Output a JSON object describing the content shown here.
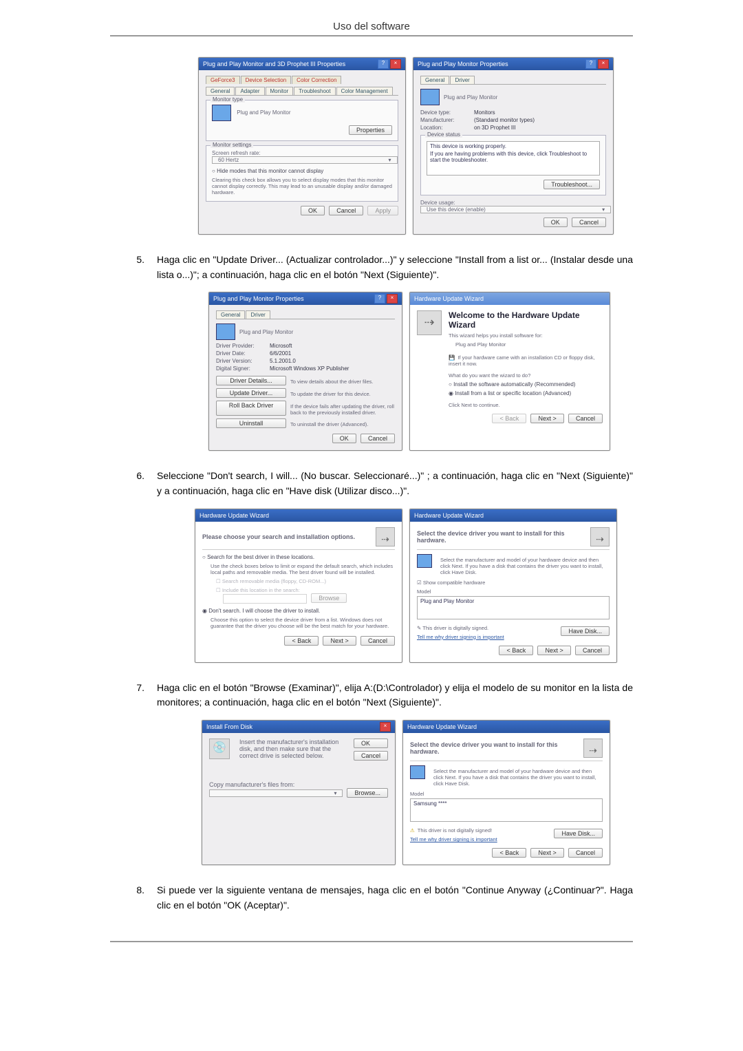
{
  "page_header": "Uso del software",
  "step5": {
    "num": "5.",
    "text": "Haga clic en \"Update Driver... (Actualizar controlador...)\" y seleccione \"Install from a list or... (Instalar desde una lista o...)\"; a continuación, haga clic en el botón \"Next (Siguiente)\"."
  },
  "step6": {
    "num": "6.",
    "text": "Seleccione \"Don't search, I will... (No buscar. Seleccionaré...)\" ; a continuación, haga clic en \"Next (Siguiente)\" y a continuación, haga clic en \"Have disk (Utilizar disco...)\"."
  },
  "step7": {
    "num": "7.",
    "text": "Haga clic en el botón \"Browse (Examinar)\", elija A:(D:\\Controlador) y elija el modelo de su monitor en la lista de monitores; a continuación, haga clic en el botón \"Next (Siguiente)\"."
  },
  "step8": {
    "num": "8.",
    "text": "Si puede ver la siguiente ventana de mensajes, haga clic en el botón \"Continue Anyway (¿Continuar?\". Haga clic en el botón \"OK (Aceptar)\"."
  },
  "dlg1a": {
    "title": "Plug and Play Monitor and 3D Prophet III Properties",
    "tabs": [
      "GeForce3",
      "Device Selection",
      "Color Correction",
      "General",
      "Adapter",
      "Monitor",
      "Troubleshoot",
      "Color Management"
    ],
    "grp_type": "Monitor type",
    "monitor": "Plug and Play Monitor",
    "btn_props": "Properties",
    "grp_settings": "Monitor settings",
    "lbl_refresh": "Screen refresh rate:",
    "val_refresh": "60 Hertz",
    "chk": "Hide modes that this monitor cannot display",
    "chk_note": "Clearing this check box allows you to select display modes that this monitor cannot display correctly. This may lead to an unusable display and/or damaged hardware.",
    "ok": "OK",
    "cancel": "Cancel",
    "apply": "Apply"
  },
  "dlg1b": {
    "title": "Plug and Play Monitor Properties",
    "tabs": [
      "General",
      "Driver"
    ],
    "name": "Plug and Play Monitor",
    "f_type_l": "Device type:",
    "f_type_v": "Monitors",
    "f_manu_l": "Manufacturer:",
    "f_manu_v": "(Standard monitor types)",
    "f_loc_l": "Location:",
    "f_loc_v": "on 3D Prophet III",
    "grp_status": "Device status",
    "status_txt": "This device is working properly.",
    "status_txt2": "If you are having problems with this device, click Troubleshoot to start the troubleshooter.",
    "btn_trouble": "Troubleshoot...",
    "lbl_usage": "Device usage:",
    "val_usage": "Use this device (enable)",
    "ok": "OK",
    "cancel": "Cancel"
  },
  "dlg2a": {
    "title": "Plug and Play Monitor Properties",
    "tabs": [
      "General",
      "Driver"
    ],
    "name": "Plug and Play Monitor",
    "f_prov_l": "Driver Provider:",
    "f_prov_v": "Microsoft",
    "f_date_l": "Driver Date:",
    "f_date_v": "6/6/2001",
    "f_ver_l": "Driver Version:",
    "f_ver_v": "5.1.2001.0",
    "f_sign_l": "Digital Signer:",
    "f_sign_v": "Microsoft Windows XP Publisher",
    "btn_details": "Driver Details...",
    "btn_details_d": "To view details about the driver files.",
    "btn_update": "Update Driver...",
    "btn_update_d": "To update the driver for this device.",
    "btn_roll": "Roll Back Driver",
    "btn_roll_d": "If the device fails after updating the driver, roll back to the previously installed driver.",
    "btn_unin": "Uninstall",
    "btn_unin_d": "To uninstall the driver (Advanced).",
    "ok": "OK",
    "cancel": "Cancel"
  },
  "dlg2b": {
    "title": "Hardware Update Wizard",
    "wiz_title": "Welcome to the Hardware Update Wizard",
    "wiz_sub": "This wizard helps you install software for:",
    "wiz_dev": "Plug and Play Monitor",
    "cd_note": "If your hardware came with an installation CD or floppy disk, insert it now.",
    "q": "What do you want the wizard to do?",
    "opt1": "Install the software automatically (Recommended)",
    "opt2": "Install from a list or specific location (Advanced)",
    "cont": "Click Next to continue.",
    "back": "< Back",
    "next": "Next >",
    "cancel": "Cancel"
  },
  "dlg3a": {
    "title": "Hardware Update Wizard",
    "head": "Please choose your search and installation options.",
    "opt1": "Search for the best driver in these locations.",
    "opt1d": "Use the check boxes below to limit or expand the default search, which includes local paths and removable media. The best driver found will be installed.",
    "chk1": "Search removable media (floppy, CD-ROM...)",
    "chk2": "Include this location in the search:",
    "browse": "Browse",
    "opt2": "Don't search. I will choose the driver to install.",
    "opt2d": "Choose this option to select the device driver from a list. Windows does not guarantee that the driver you choose will be the best match for your hardware.",
    "back": "< Back",
    "next": "Next >",
    "cancel": "Cancel"
  },
  "dlg3b": {
    "title": "Hardware Update Wizard",
    "head": "Select the device driver you want to install for this hardware.",
    "sub": "Select the manufacturer and model of your hardware device and then click Next. If you have a disk that contains the driver you want to install, click Have Disk.",
    "compat": "Show compatible hardware",
    "model_l": "Model",
    "model_v": "Plug and Play Monitor",
    "signed": "This driver is digitally signed.",
    "tell": "Tell me why driver signing is important",
    "havedisk": "Have Disk...",
    "back": "< Back",
    "next": "Next >",
    "cancel": "Cancel"
  },
  "dlg4a": {
    "title": "Install From Disk",
    "msg": "Insert the manufacturer's installation disk, and then make sure that the correct drive is selected below.",
    "ok": "OK",
    "cancel": "Cancel",
    "copy_l": "Copy manufacturer's files from:",
    "browse": "Browse..."
  },
  "dlg4b": {
    "title": "Hardware Update Wizard",
    "head": "Select the device driver you want to install for this hardware.",
    "sub": "Select the manufacturer and model of your hardware device and then click Next. If you have a disk that contains the driver you want to install, click Have Disk.",
    "model_l": "Model",
    "model_v": "Samsung ****",
    "unsigned": "This driver is not digitally signed!",
    "tell": "Tell me why driver signing is important",
    "havedisk": "Have Disk...",
    "back": "< Back",
    "next": "Next >",
    "cancel": "Cancel"
  }
}
